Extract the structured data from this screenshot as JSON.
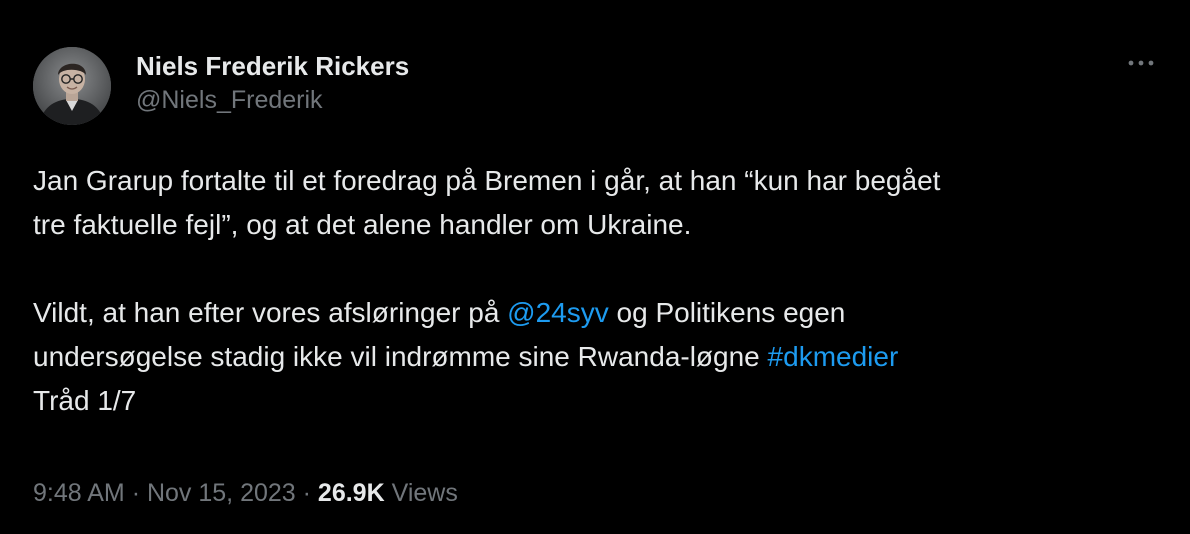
{
  "author": {
    "display_name": "Niels Frederik Rickers",
    "handle": "@Niels_Frederik"
  },
  "more_icon": "more-horizontal-icon",
  "tweet": {
    "line1": "Jan Grarup fortalte til et foredrag på Bremen i går, at han “kun har begået",
    "line2": "tre faktuelle fejl”, og at det alene handler om Ukraine.",
    "line3_pre": "Vildt, at han efter vores afsløringer på ",
    "mention": "@24syv",
    "line3_post": " og Politikens egen",
    "line4_pre": "undersøgelse stadig ikke vil indrømme sine Rwanda-løgne ",
    "hashtag": "#dkmedier",
    "line5": "Tråd 1/7"
  },
  "meta": {
    "time": "9:48 AM",
    "separator": "·",
    "date": "Nov 15, 2023",
    "views_count": "26.9K",
    "views_label": "Views"
  },
  "colors": {
    "background": "#000000",
    "text": "#e7e9ea",
    "secondary": "#71767b",
    "link": "#1d9bf0"
  }
}
